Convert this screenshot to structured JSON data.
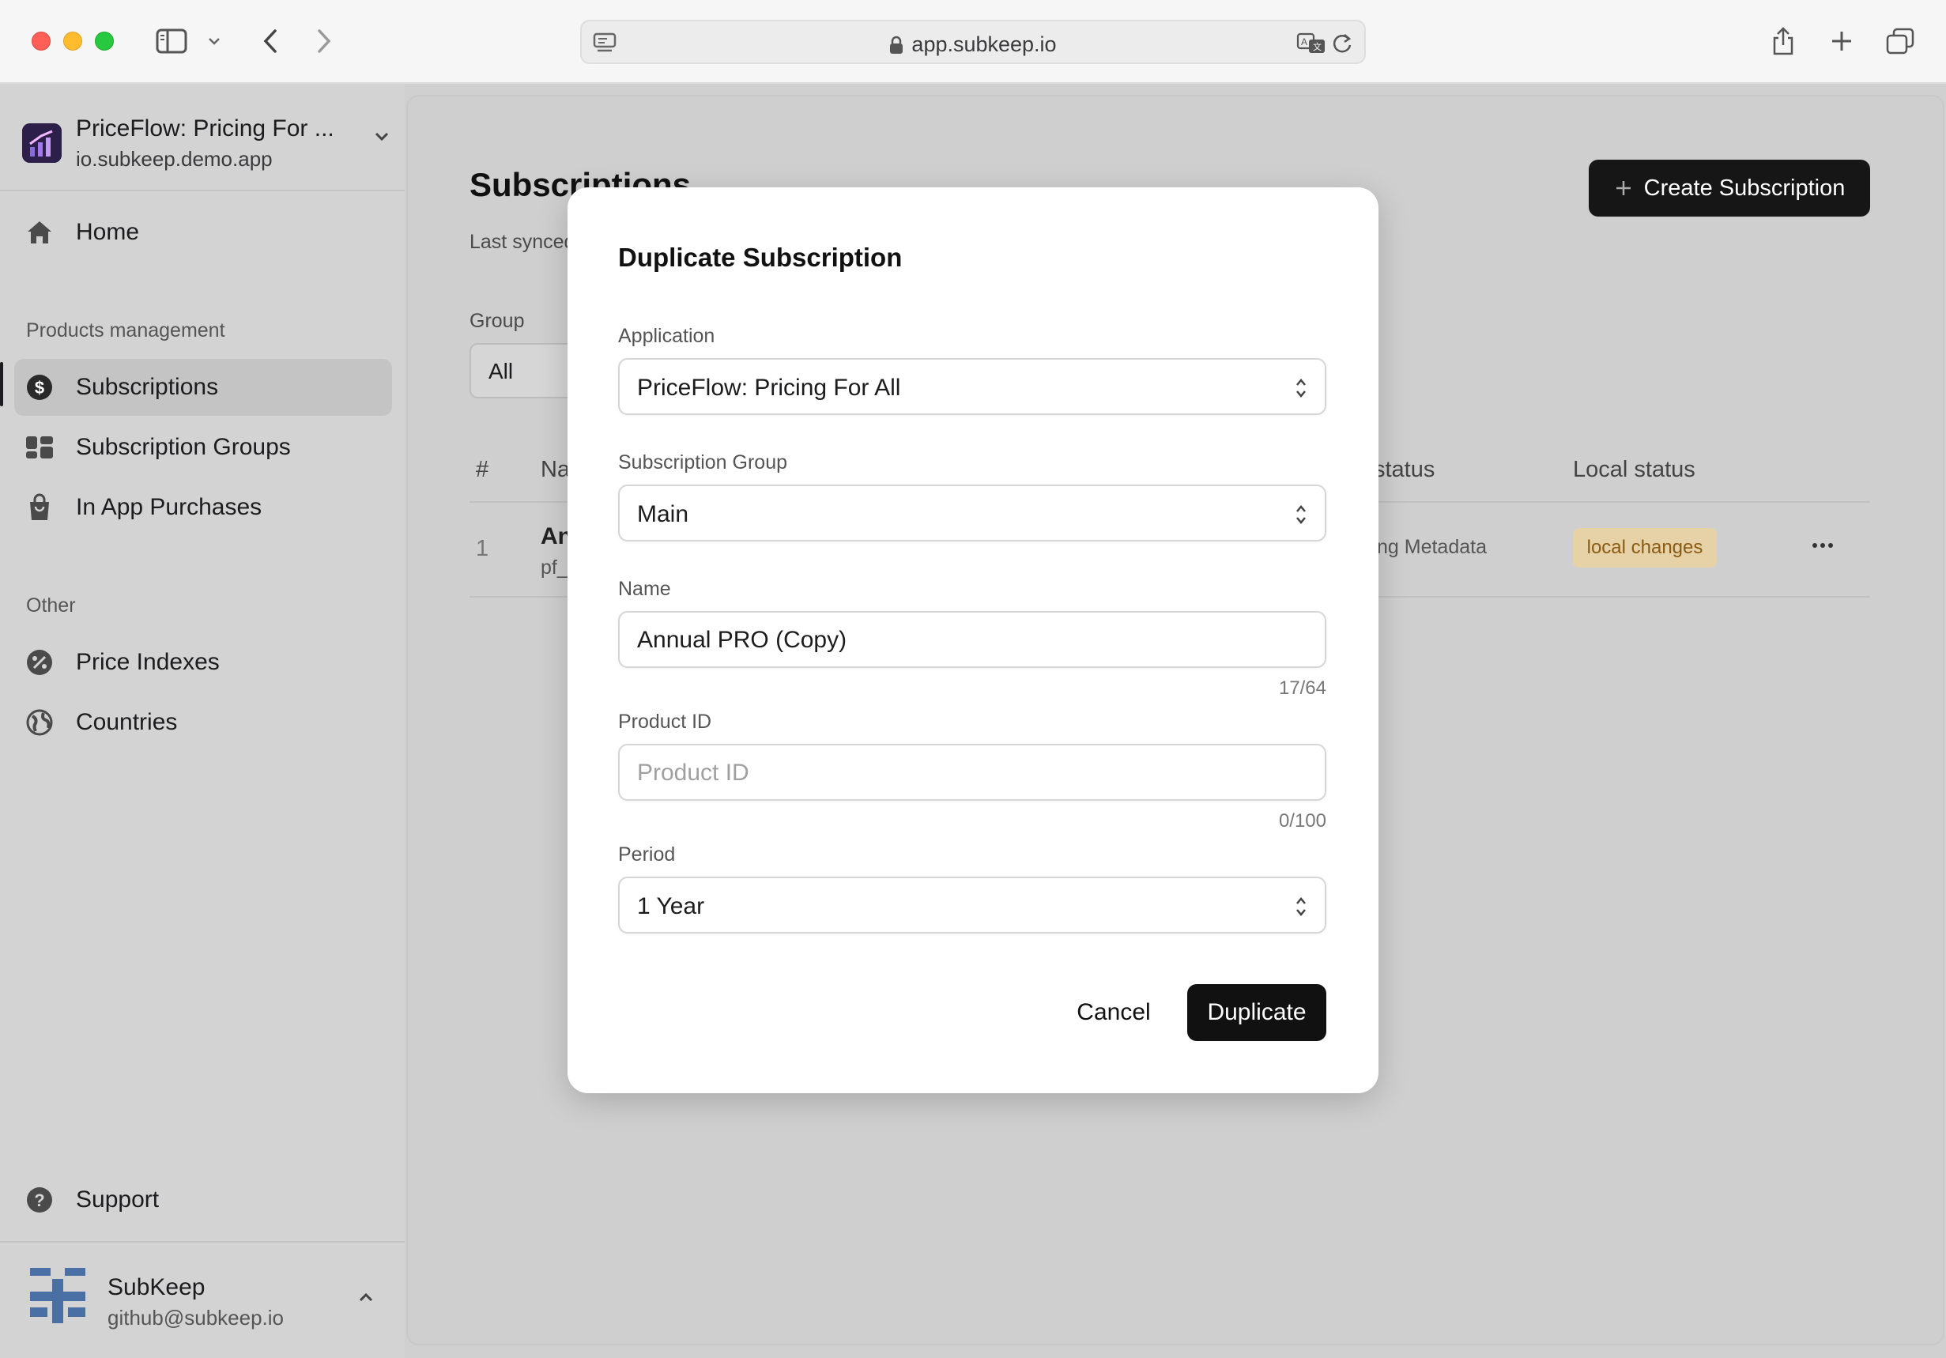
{
  "browser": {
    "url": "app.subkeep.io"
  },
  "sidebar": {
    "app_name": "PriceFlow: Pricing For ...",
    "app_bundle": "io.subkeep.demo.app",
    "home_label": "Home",
    "section_products": "Products management",
    "items_products": [
      {
        "label": "Subscriptions",
        "active": true
      },
      {
        "label": "Subscription Groups",
        "active": false
      },
      {
        "label": "In App Purchases",
        "active": false
      }
    ],
    "section_other": "Other",
    "items_other": [
      {
        "label": "Price Indexes"
      },
      {
        "label": "Countries"
      }
    ],
    "support_label": "Support",
    "user": {
      "name": "SubKeep",
      "email": "github@subkeep.io"
    }
  },
  "main": {
    "title": "Subscriptions",
    "last_synced": "Last synced",
    "create_button": "Create Subscription",
    "group_filter_label": "Group",
    "group_filter_value": "All",
    "table": {
      "headers": [
        "#",
        "Na",
        "status",
        "Local status"
      ],
      "rows": [
        {
          "index": "1",
          "name": "An",
          "product_id": "pf_",
          "status": "ng Metadata",
          "local_status": "local changes"
        }
      ]
    }
  },
  "modal": {
    "title": "Duplicate Subscription",
    "application_label": "Application",
    "application_value": "PriceFlow: Pricing For All",
    "group_label": "Subscription Group",
    "group_value": "Main",
    "name_label": "Name",
    "name_value": "Annual PRO (Copy)",
    "name_counter": "17/64",
    "product_id_label": "Product ID",
    "product_id_placeholder": "Product ID",
    "product_id_value": "",
    "product_id_counter": "0/100",
    "period_label": "Period",
    "period_value": "1 Year",
    "cancel_button": "Cancel",
    "duplicate_button": "Duplicate"
  },
  "colors": {
    "primary_button": "#161616",
    "badge_bg": "#e6d2a6",
    "badge_text": "#8a5a12",
    "overlay": "#d0d0d0"
  }
}
